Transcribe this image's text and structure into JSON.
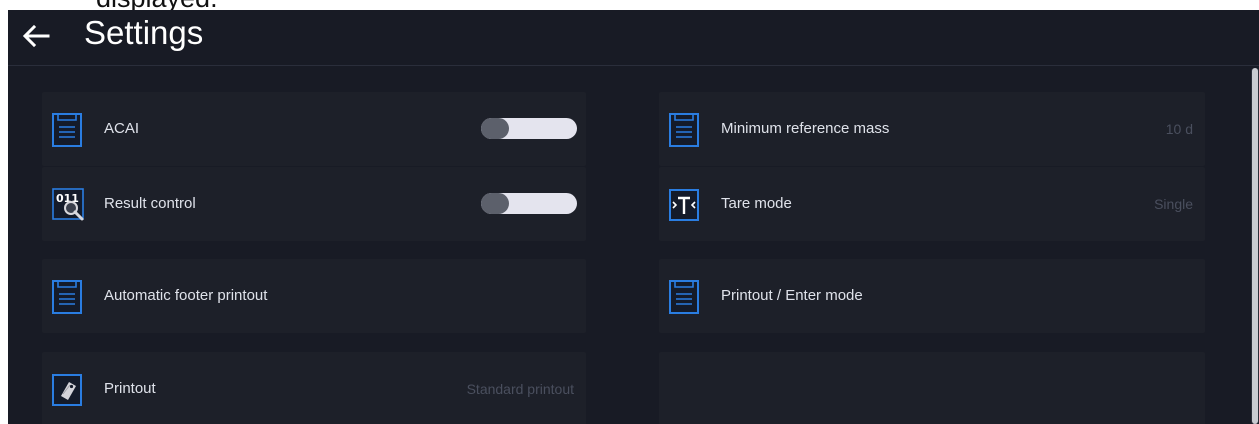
{
  "overlay_text": "displayed.",
  "header": {
    "title": "Settings",
    "back_icon": "back-arrow-icon"
  },
  "settings": {
    "acai": {
      "label": "ACAI",
      "icon": "document-icon",
      "toggle_on": false
    },
    "min_reference_mass": {
      "label": "Minimum reference mass",
      "icon": "document-icon",
      "value": "10 d"
    },
    "result_control": {
      "label": "Result control",
      "icon": "magnifier-binary-icon",
      "toggle_on": false
    },
    "tare_mode": {
      "label": "Tare mode",
      "icon": "tare-icon",
      "value": "Single"
    },
    "auto_footer": {
      "label": "Automatic footer printout",
      "icon": "document-icon"
    },
    "printout_enter": {
      "label": "Printout / Enter mode",
      "icon": "document-icon"
    },
    "printout": {
      "label": "Printout",
      "icon": "tag-icon",
      "value": "Standard printout"
    }
  },
  "colors": {
    "accent": "#2a7de1",
    "background": "#181b25",
    "tile": "#1d2029"
  }
}
